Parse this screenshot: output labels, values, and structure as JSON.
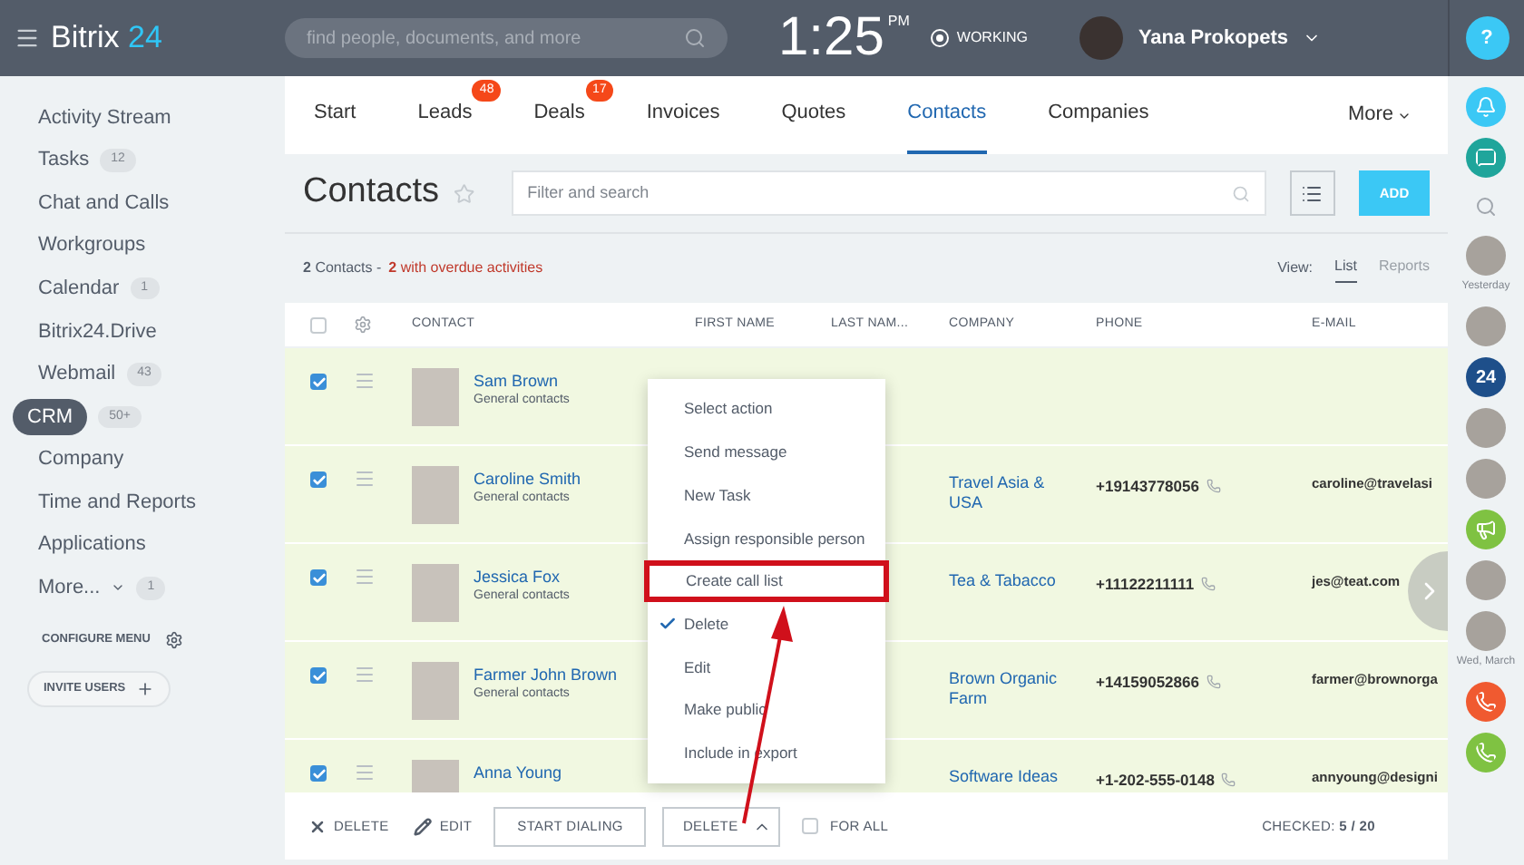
{
  "top_bar": {
    "logo": {
      "name": "Bitrix",
      "suffix": "24"
    },
    "search": {
      "placeholder": "find people, documents, and more"
    },
    "clock": {
      "time": "1:25",
      "period": "PM"
    },
    "work_status": "WORKING",
    "user": "Yana Prokopets",
    "help": "?"
  },
  "sidebar": {
    "items": [
      {
        "label": "Activity Stream",
        "selected": false
      },
      {
        "label": "Tasks",
        "count": "12",
        "selected": false
      },
      {
        "label": "Chat and Calls",
        "selected": false
      },
      {
        "label": "Workgroups",
        "selected": false
      },
      {
        "label": "Calendar",
        "count": "1",
        "selected": false
      },
      {
        "label": "Bitrix24.Drive",
        "selected": false
      },
      {
        "label": "Webmail",
        "count": "43",
        "selected": false
      },
      {
        "label": "CRM",
        "count": "50+",
        "selected": true
      },
      {
        "label": "Company",
        "selected": false
      },
      {
        "label": "Time and Reports",
        "selected": false
      },
      {
        "label": "Applications",
        "selected": false
      },
      {
        "label": "More...",
        "count": "1",
        "selected": false,
        "caret": true
      }
    ],
    "configure": "CONFIGURE MENU",
    "invite": "INVITE USERS"
  },
  "tabs": [
    {
      "label": "Start",
      "selected": false
    },
    {
      "label": "Leads",
      "badge": "48",
      "selected": false
    },
    {
      "label": "Deals",
      "badge": "17",
      "selected": false
    },
    {
      "label": "Invoices",
      "selected": false
    },
    {
      "label": "Quotes",
      "selected": false
    },
    {
      "label": "Contacts",
      "selected": true
    },
    {
      "label": "Companies",
      "selected": false
    }
  ],
  "more_tab": "More",
  "page": {
    "title": "Contacts",
    "filter": {
      "placeholder": "Filter and search"
    },
    "add_button": "ADD"
  },
  "summary": {
    "count": "2",
    "text": "Contacts -",
    "overdue_count": "2",
    "overdue_text": "with overdue activities"
  },
  "view": {
    "label": "View:",
    "options": [
      {
        "label": "List",
        "selected": true
      },
      {
        "label": "Reports",
        "selected": false
      }
    ]
  },
  "table": {
    "select_all": {
      "checked": false
    },
    "columns": [
      "CONTACT",
      "FIRST NAME",
      "LAST NAM...",
      "COMPANY",
      "PHONE",
      "E-MAIL"
    ],
    "rows": [
      {
        "checked": true,
        "name": "Sam Brown",
        "type": "General contacts"
      },
      {
        "checked": true,
        "name": "Caroline Smith",
        "type": "General contacts",
        "company": "Travel Asia & USA",
        "phone": "+19143778056",
        "email": "caroline@travelasi"
      },
      {
        "checked": true,
        "name": "Jessica Fox",
        "type": "General contacts",
        "company": "Tea & Tabacco",
        "phone": "+11122211111",
        "email": "jes@teat.com"
      },
      {
        "checked": true,
        "name": "Farmer John Brown",
        "type": "General contacts",
        "company": "Brown Organic Farm",
        "phone": "+14159052866",
        "email": "farmer@brownorga"
      },
      {
        "checked": true,
        "name": "Anna Young",
        "company": "Software Ideas",
        "phone": "+1-202-555-0148",
        "email": "annyoung@designi"
      }
    ]
  },
  "action_menu": [
    {
      "label": "Select action",
      "checked": false,
      "highlighted": false
    },
    {
      "label": "Send message",
      "checked": false,
      "highlighted": false
    },
    {
      "label": "New Task",
      "checked": false,
      "highlighted": false
    },
    {
      "label": "Assign responsible person",
      "checked": false,
      "highlighted": false
    },
    {
      "label": "Create call list",
      "checked": false,
      "highlighted": true
    },
    {
      "label": "Delete",
      "checked": true,
      "highlighted": false
    },
    {
      "label": "Edit",
      "checked": false,
      "highlighted": false
    },
    {
      "label": "Make public",
      "checked": false,
      "highlighted": false
    },
    {
      "label": "Include in export",
      "checked": false,
      "highlighted": false
    }
  ],
  "bottom_bar": {
    "delete": "DELETE",
    "edit": "EDIT",
    "start_dialing": "START DIALING",
    "action_select": "DELETE",
    "for_all": {
      "label": "FOR ALL",
      "checked": false
    },
    "checked_count": "CHECKED: **5 / 20**"
  },
  "right_bar": {
    "items": [
      {
        "kind": "avatar"
      },
      {
        "kind": "date",
        "label": "Yesterday"
      },
      {
        "kind": "avatar"
      },
      {
        "kind": "badge",
        "label": "24"
      },
      {
        "kind": "avatar"
      },
      {
        "kind": "avatar"
      },
      {
        "kind": "megaphone"
      },
      {
        "kind": "avatar"
      },
      {
        "kind": "avatar"
      },
      {
        "kind": "date",
        "label": "Wed, March"
      },
      {
        "kind": "call"
      },
      {
        "kind": "phone"
      }
    ]
  }
}
